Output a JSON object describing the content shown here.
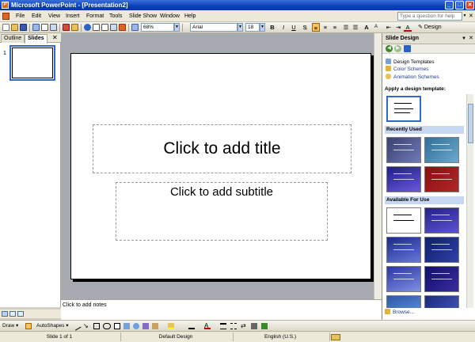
{
  "window": {
    "title": "Microsoft PowerPoint - [Presentation2]",
    "min": "_",
    "max": "□",
    "close": "✕"
  },
  "menu": {
    "items": [
      "File",
      "Edit",
      "View",
      "Insert",
      "Format",
      "Tools",
      "Slide Show",
      "Window",
      "Help"
    ],
    "ask_placeholder": "Type a question for help",
    "doc_close": "✕"
  },
  "toolbar": {
    "zoom": "68%",
    "font": "Arial",
    "font_size": "18",
    "bold": "B",
    "italic": "I",
    "underline": "U",
    "shadow": "S",
    "grow_font": "A",
    "font_color": "A",
    "design": "Design"
  },
  "left_pane": {
    "tab_outline": "Outline",
    "tab_slides": "Slides",
    "close": "✕",
    "slide_number": "1"
  },
  "slide": {
    "title_placeholder": "Click to add title",
    "subtitle_placeholder": "Click to add subtitle"
  },
  "notes": {
    "placeholder": "Click to add notes"
  },
  "task_pane": {
    "title": "Slide Design",
    "menu_arrow": "▼",
    "close": "✕",
    "links": [
      "Design Templates",
      "Color Schemes",
      "Animation Schemes"
    ],
    "apply_label": "Apply a design template:",
    "section_recent": "Recently Used",
    "section_available": "Available For Use",
    "browse": "Browse..."
  },
  "drawing": {
    "draw": "Draw",
    "autoshapes": "AutoShapes"
  },
  "status": {
    "slide": "Slide 1 of 1",
    "design": "Default Design",
    "language": "English (U.S.)"
  }
}
